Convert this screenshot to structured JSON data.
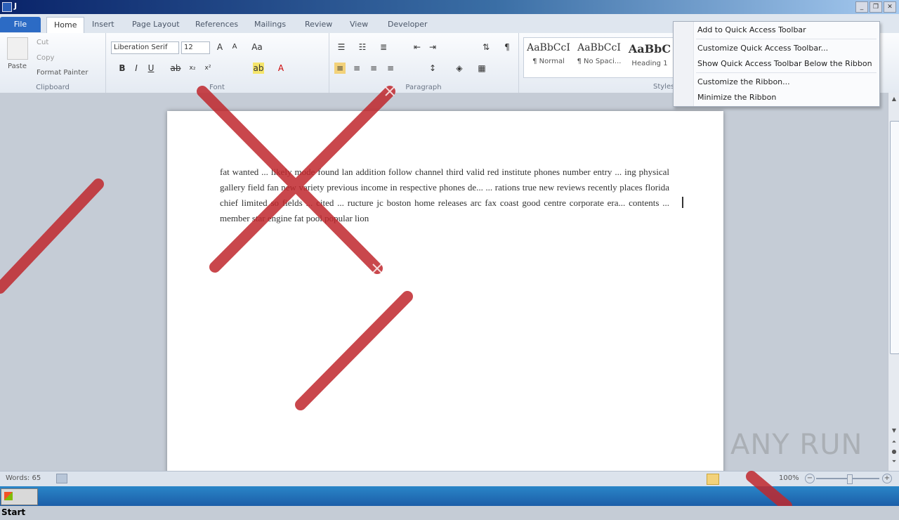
{
  "window": {
    "title": "J"
  },
  "tabs": [
    "File",
    "Home",
    "Insert",
    "Page Layout",
    "References",
    "Mailings",
    "Review",
    "View",
    "Developer"
  ],
  "ribbon": {
    "clipboard": {
      "label": "Clipboard",
      "paste": "Paste",
      "cut": "Cut",
      "copy": "Copy",
      "format_painter": "Format Painter"
    },
    "font": {
      "label": "Font",
      "name": "Liberation Serif",
      "size": "12"
    },
    "paragraph": {
      "label": "Paragraph"
    },
    "styles": {
      "label": "Styles",
      "items": [
        {
          "sample": "AaBbCcI",
          "name": "¶ Normal"
        },
        {
          "sample": "AaBbCcI",
          "name": "¶ No Spaci..."
        },
        {
          "sample": "AaBbC",
          "name": "Heading 1"
        }
      ]
    }
  },
  "document": {
    "text": "fat wanted ... likely mode found lan addition follow channel third valid red institute phones number entry ... ing physical gallery field fan new variety previous income in respective phones de... ... rations true new reviews recently places florida chief limited so fields ... cited ... ructure jc boston home releases arc fax coast good centre corporate era... contents ... member star engine fat pool popular lion"
  },
  "context_menu": {
    "items": [
      "Add to Quick Access Toolbar",
      "Customize Quick Access Toolbar...",
      "Show Quick Access Toolbar Below the Ribbon",
      "Customize the Ribbon...",
      "Minimize the Ribbon"
    ]
  },
  "status": {
    "words": "Words: 65",
    "zoom": "100%"
  },
  "taskbar": {
    "start": "Start"
  },
  "watermark": "ANY RUN",
  "colors": {
    "accent": "#2c6bc5",
    "cursor_trail": "#c0282d",
    "taskbar": "#1c5ea8"
  }
}
